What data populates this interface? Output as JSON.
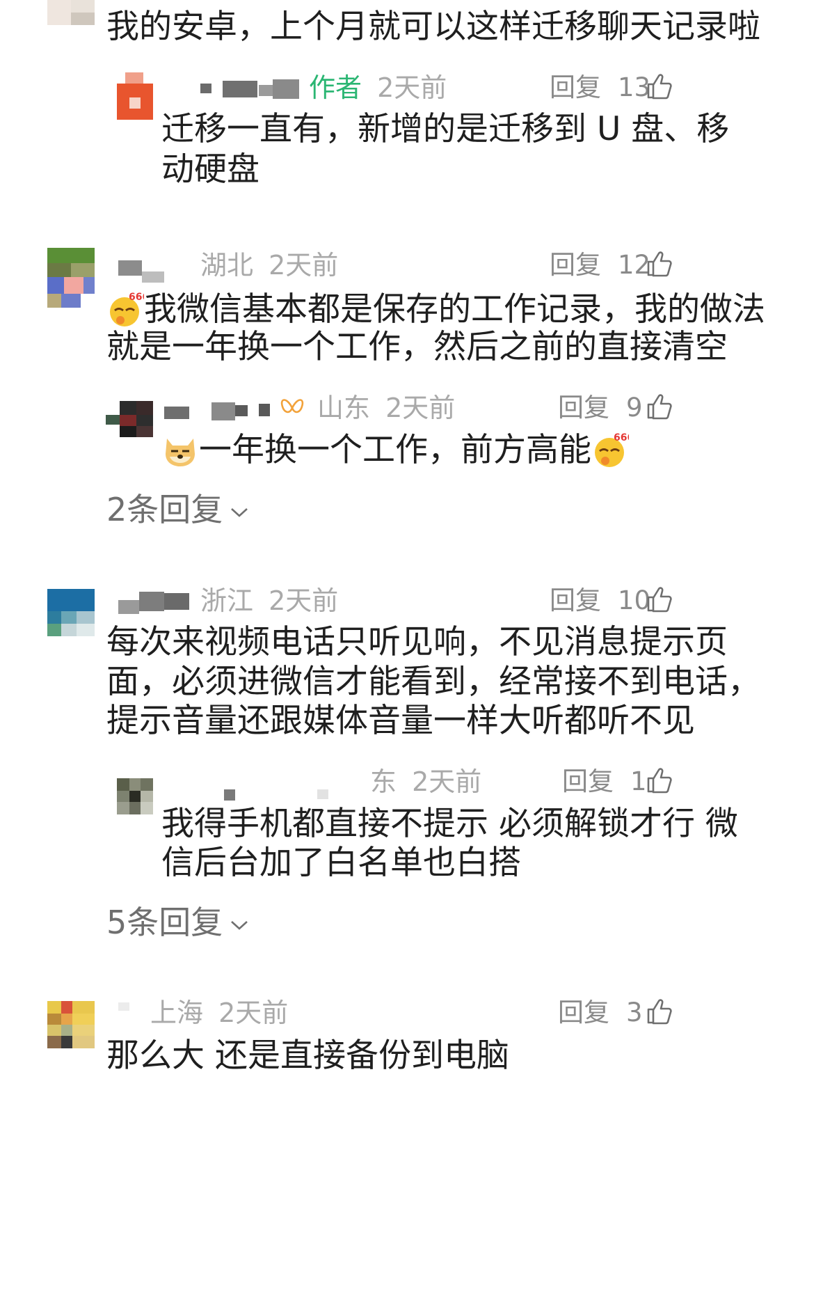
{
  "comments": [
    {
      "content": "我的安卓，上个月就可以这样迁移聊天记录啦",
      "replies": [
        {
          "author_tag": "作者",
          "time": "2天前",
          "reply_label": "回复",
          "likes": "13",
          "content_lines": [
            "迁移一直有，新增的是迁移到 U 盘、移",
            "动硬盘"
          ]
        }
      ]
    },
    {
      "location": "湖北",
      "time": "2天前",
      "reply_label": "回复",
      "likes": "12",
      "content_lines": [
        "我微信基本都是保存的工作记录，我的做法",
        "就是一年换一个工作，然后之前的直接清空"
      ],
      "replies": [
        {
          "location": "山东",
          "time": "2天前",
          "reply_label": "回复",
          "likes": "9",
          "content": "一年换一个工作，前方高能"
        }
      ],
      "more_replies": "2条回复"
    },
    {
      "location": "浙江",
      "time": "2天前",
      "reply_label": "回复",
      "likes": "10",
      "content_lines": [
        "每次来视频电话只听见响，不见消息提示页",
        "面，必须进微信才能看到，经常接不到电话，",
        "提示音量还跟媒体音量一样大听都听不见"
      ],
      "replies": [
        {
          "location": "东",
          "time": "2天前",
          "reply_label": "回复",
          "likes": "1",
          "content_lines": [
            "我得手机都直接不提示 必须解锁才行 微",
            "信后台加了白名单也白搭"
          ]
        }
      ],
      "more_replies": "5条回复"
    },
    {
      "location": "上海",
      "time": "2天前",
      "reply_label": "回复",
      "likes": "3",
      "content": "那么大 还是直接备份到电脑"
    }
  ],
  "emoji": {
    "emoji_666": "666"
  },
  "colors": {
    "author_green": "#2bb673",
    "meta_gray": "#a9a9a9",
    "text": "#1f1f1f"
  }
}
